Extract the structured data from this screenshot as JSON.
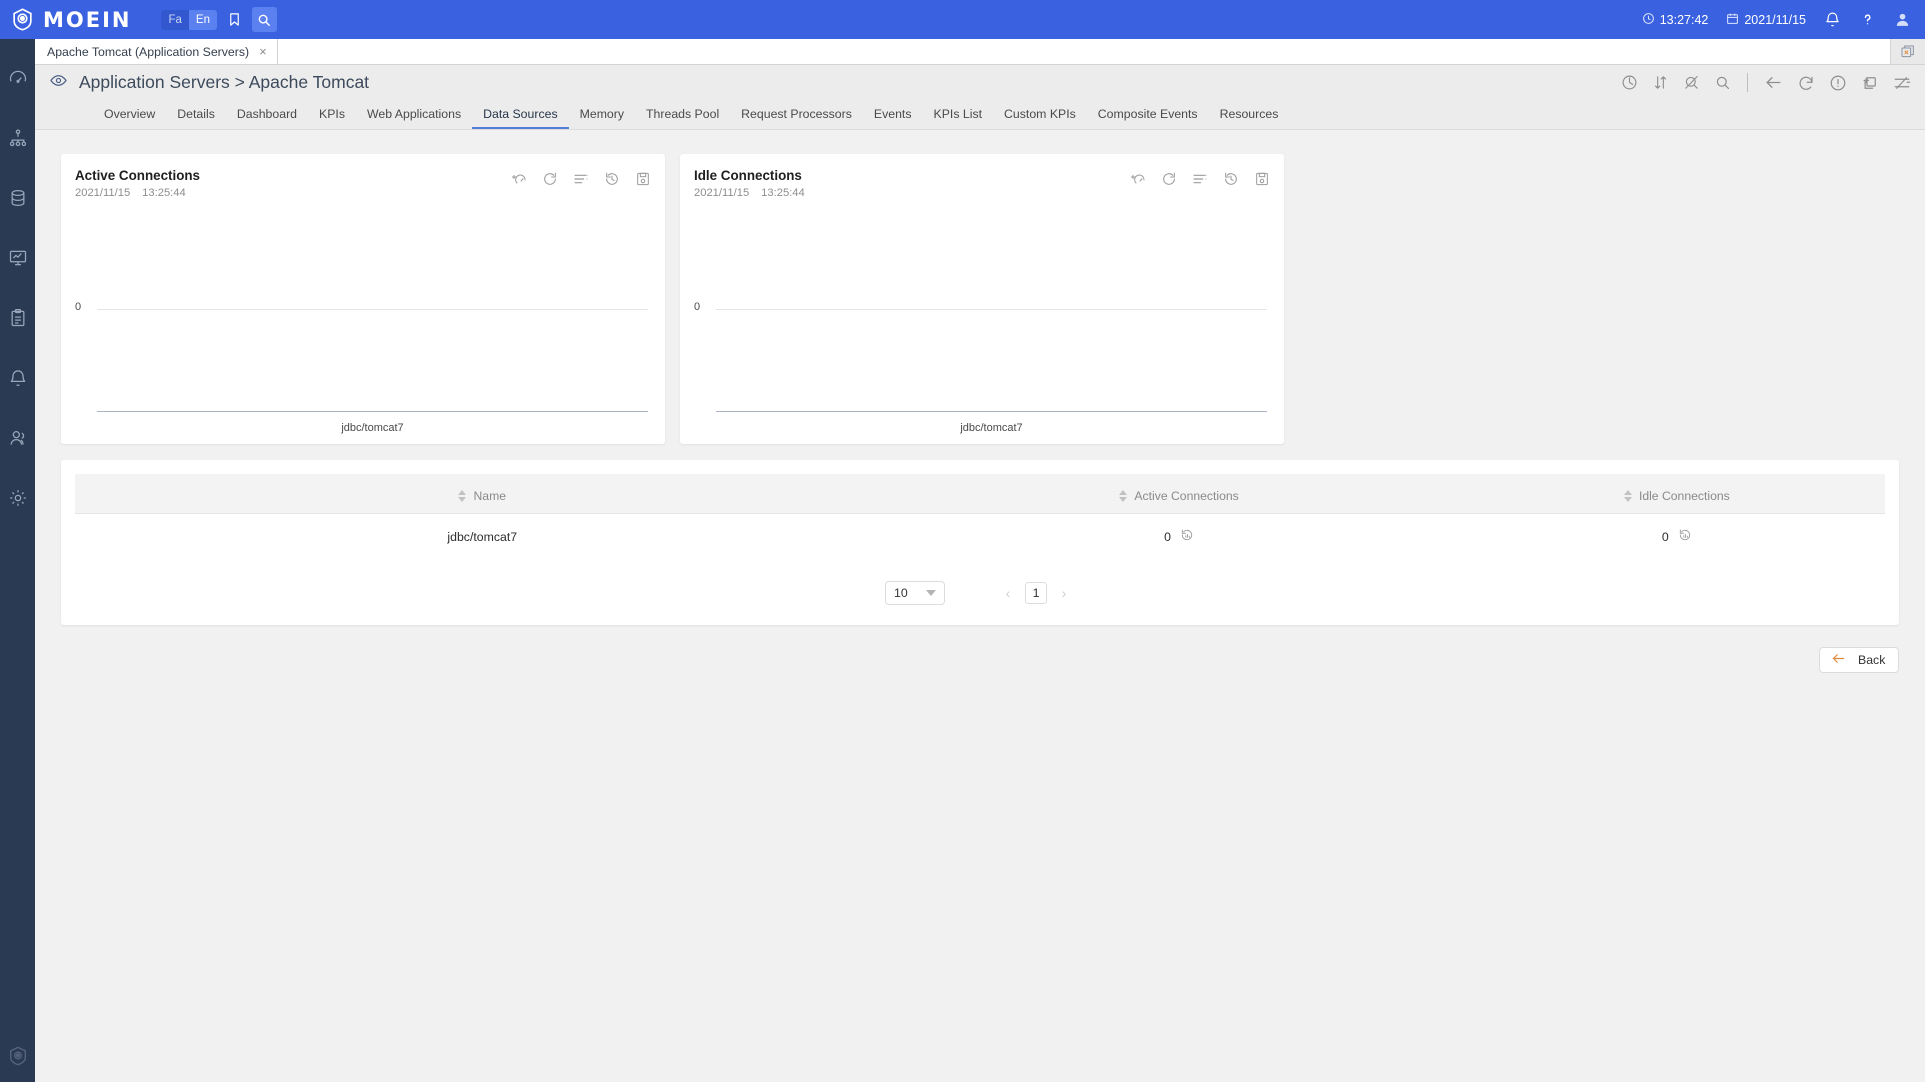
{
  "topbar": {
    "brand": "MOEIN",
    "lang": {
      "fa": "Fa",
      "en": "En",
      "active": "En"
    },
    "time": "13:27:42",
    "date": "2021/11/15",
    "accent": "#3a62e0"
  },
  "tabstrip": {
    "tabs": [
      {
        "label": "Apache Tomcat (Application Servers)",
        "close": "×"
      }
    ]
  },
  "page": {
    "title": "Application Servers > Apache Tomcat"
  },
  "nav": {
    "tabs": [
      {
        "label": "Overview",
        "active": false
      },
      {
        "label": "Details",
        "active": false
      },
      {
        "label": "Dashboard",
        "active": false
      },
      {
        "label": "KPIs",
        "active": false
      },
      {
        "label": "Web Applications",
        "active": false
      },
      {
        "label": "Data Sources",
        "active": true
      },
      {
        "label": "Memory",
        "active": false
      },
      {
        "label": "Threads Pool",
        "active": false
      },
      {
        "label": "Request Processors",
        "active": false
      },
      {
        "label": "Events",
        "active": false
      },
      {
        "label": "KPIs List",
        "active": false
      },
      {
        "label": "Custom KPIs",
        "active": false
      },
      {
        "label": "Composite Events",
        "active": false
      },
      {
        "label": "Resources",
        "active": false
      }
    ]
  },
  "cards": [
    {
      "title": "Active Connections",
      "date": "2021/11/15",
      "time": "13:25:44"
    },
    {
      "title": "Idle Connections",
      "date": "2021/11/15",
      "time": "13:25:44"
    }
  ],
  "chart_data": [
    {
      "type": "bar",
      "title": "Active Connections",
      "categories": [
        "jdbc/tomcat7"
      ],
      "values": [
        0
      ],
      "xlabel": "jdbc/tomcat7",
      "ylabel": "",
      "ytick_labels": [
        "0"
      ],
      "ylim": [
        0,
        0
      ],
      "grid": true,
      "legend": "none"
    },
    {
      "type": "bar",
      "title": "Idle Connections",
      "categories": [
        "jdbc/tomcat7"
      ],
      "values": [
        0
      ],
      "xlabel": "jdbc/tomcat7",
      "ylabel": "",
      "ytick_labels": [
        "0"
      ],
      "ylim": [
        0,
        0
      ],
      "grid": true,
      "legend": "none"
    }
  ],
  "table": {
    "columns": [
      "Name",
      "Active Connections",
      "Idle Connections"
    ],
    "rows": [
      {
        "name": "jdbc/tomcat7",
        "active": "0",
        "idle": "0"
      }
    ]
  },
  "pager": {
    "page_size": "10",
    "current_page": "1",
    "prev": "‹",
    "next": "›"
  },
  "footer": {
    "back_label": "Back"
  },
  "sidebar": {
    "items": [
      {
        "icon": "gauge-icon"
      },
      {
        "icon": "topology-icon"
      },
      {
        "icon": "database-icon"
      },
      {
        "icon": "monitor-chart-icon"
      },
      {
        "icon": "clipboard-icon"
      },
      {
        "icon": "bell-icon"
      },
      {
        "icon": "users-icon"
      },
      {
        "icon": "gear-icon"
      }
    ]
  }
}
